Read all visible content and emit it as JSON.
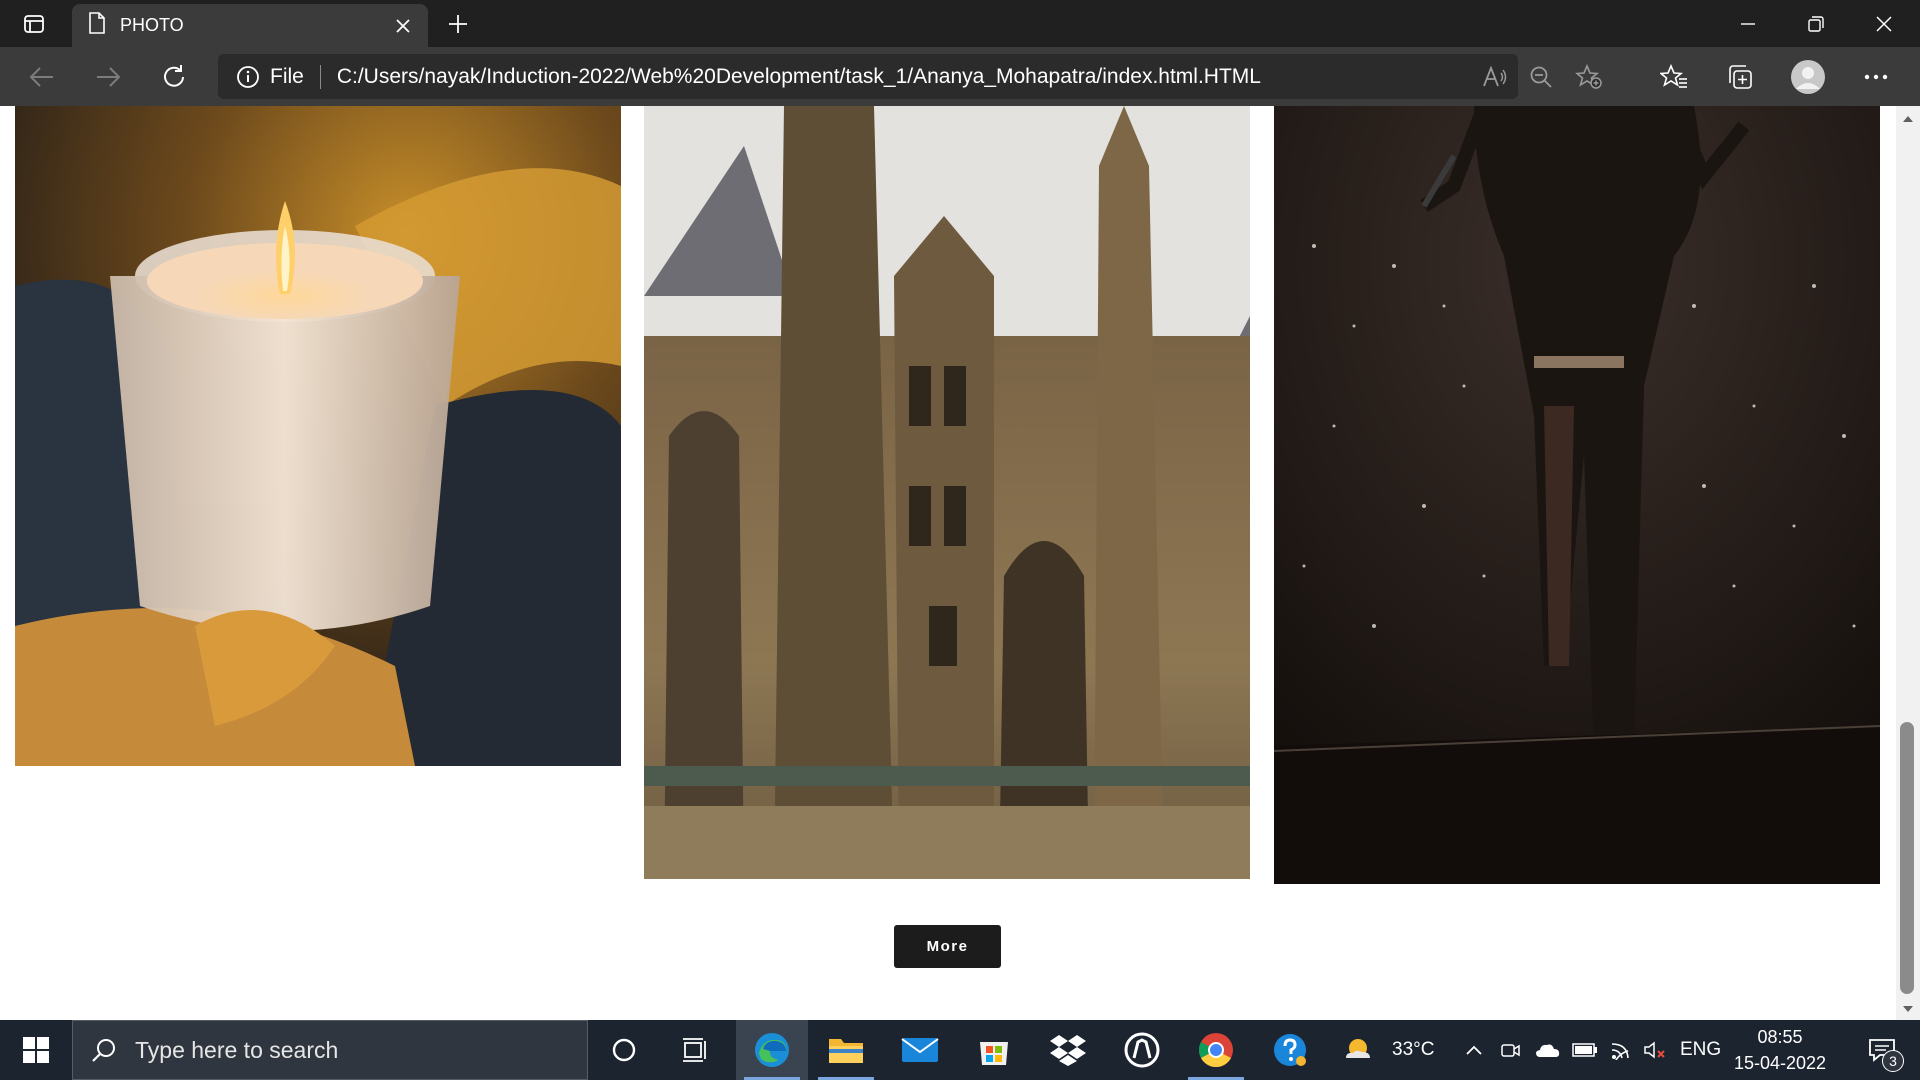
{
  "browser": {
    "tab_title": "PHOTO",
    "address": {
      "scheme_label": "File",
      "url": "C:/Users/nayak/Induction-2022/Web%20Development/task_1/Ananya_Mohapatra/index.html.HTML"
    }
  },
  "page": {
    "photos": [
      {
        "subject": "candle"
      },
      {
        "subject": "gothic-cathedral"
      },
      {
        "subject": "singer-on-stage"
      }
    ],
    "more_label": "More"
  },
  "taskbar": {
    "search_placeholder": "Type here to search",
    "weather": {
      "temperature": "33°C"
    },
    "language": "ENG",
    "time": "08:55",
    "date": "15-04-2022",
    "notification_count": "3"
  },
  "colors": {
    "titlebar": "#202020",
    "toolbar": "#3b3b3b",
    "taskbar": "#1c2430",
    "button": "#1c1c1c"
  }
}
